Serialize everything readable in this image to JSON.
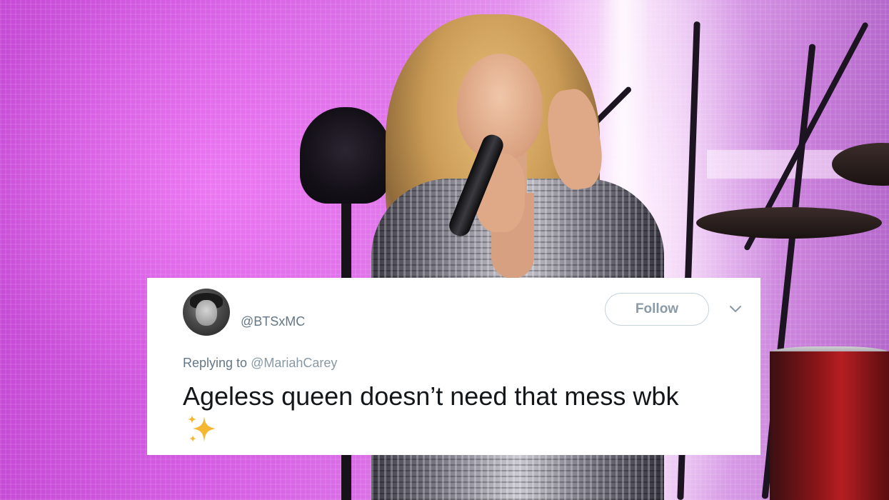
{
  "tweet": {
    "handle": "@BTSxMC",
    "follow_label": "Follow",
    "replying_prefix": "Replying to",
    "replying_to": "@MariahCarey",
    "text": "Ageless queen doesn’t need that mess wbk",
    "emoji": "sparkles-icon"
  },
  "photo": {
    "subject": "stage-performance",
    "background_color": "#d65ee4"
  },
  "colors": {
    "card": "#ffffff",
    "muted_text": "#657786",
    "main_text": "#14171a",
    "follow_border": "#c8d4dc",
    "sparkle": "#f5b731"
  }
}
